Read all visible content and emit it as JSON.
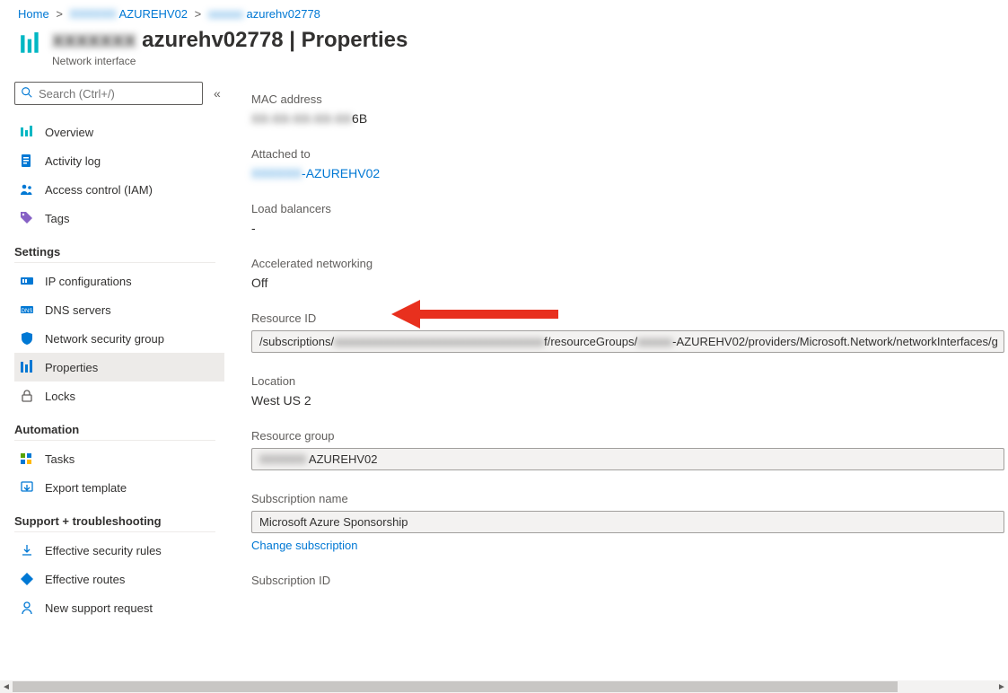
{
  "breadcrumb": {
    "home": "Home",
    "level1_blur": "XXXXXX",
    "level1_suffix": " AZUREHV02",
    "level2_blur": "xxxxxx",
    "level2_suffix": " azurehv02778"
  },
  "header": {
    "title_blur": "xxxxxxx",
    "title_main": " azurehv02778 | Properties",
    "subtitle": "Network interface"
  },
  "search": {
    "placeholder": "Search (Ctrl+/)"
  },
  "nav": {
    "overview": "Overview",
    "activity": "Activity log",
    "iam": "Access control (IAM)",
    "tags": "Tags",
    "section_settings": "Settings",
    "ipconfig": "IP configurations",
    "dns": "DNS servers",
    "nsg": "Network security group",
    "properties": "Properties",
    "locks": "Locks",
    "section_automation": "Automation",
    "tasks": "Tasks",
    "export": "Export template",
    "section_support": "Support + troubleshooting",
    "secrules": "Effective security rules",
    "routes": "Effective routes",
    "support": "New support request"
  },
  "props": {
    "mac_label": "MAC address",
    "mac_blur": "XX-XX-XX-XX-XX",
    "mac_suffix": "6B",
    "attached_label": "Attached to",
    "attached_blur": "XXXXXX",
    "attached_suffix": "-AZUREHV02",
    "lb_label": "Load balancers",
    "lb_value": "-",
    "accel_label": "Accelerated networking",
    "accel_value": "Off",
    "resid_label": "Resource ID",
    "resid_p1": "/subscriptions/",
    "resid_blur1": "xxxxxxxxxxxxxxxxxxxxxxxxxxxxxxxxxxxx",
    "resid_p2": "f/resourceGroups/",
    "resid_blur2": "xxxxxx",
    "resid_p3": "-AZUREHV02/providers/Microsoft.Network/networkInterfaces/g",
    "location_label": "Location",
    "location_value": "West US 2",
    "rg_label": "Resource group",
    "rg_blur": "XXXXXX",
    "rg_suffix": " AZUREHV02",
    "subname_label": "Subscription name",
    "subname_value": "Microsoft Azure Sponsorship",
    "change_sub": "Change subscription",
    "subid_label": "Subscription ID"
  },
  "colors": {
    "azure_blue": "#0078d4",
    "accent_teal": "#00b7c3",
    "arrow_red": "#e8301e"
  }
}
